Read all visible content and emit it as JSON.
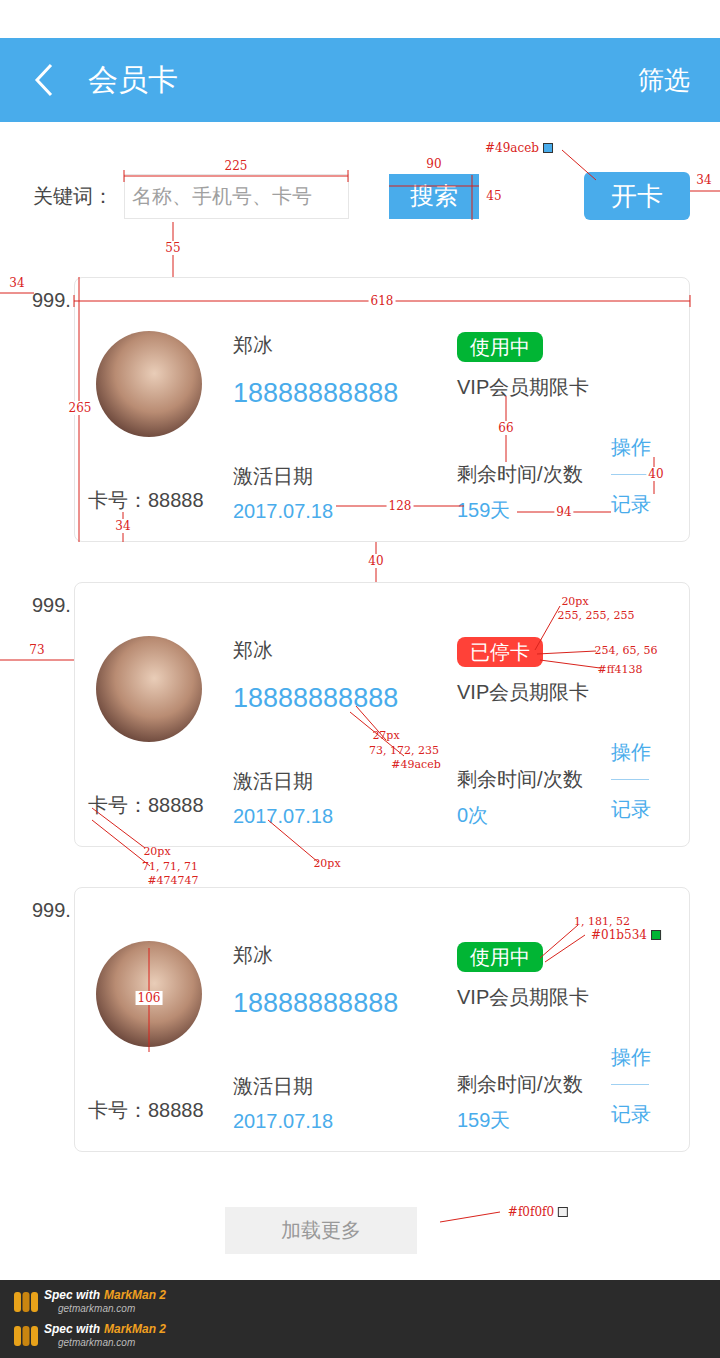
{
  "header": {
    "title": "会员卡",
    "action": "筛选"
  },
  "search": {
    "label": "关键词：",
    "placeholder": "名称、手机号、卡号",
    "button": "搜索"
  },
  "open_card_button": "开卡",
  "cards": [
    {
      "index": "999.",
      "name": "郑冰",
      "phone": "18888888888",
      "status": "使用中",
      "color": "#01b534",
      "card_type": "VIP会员期限卡",
      "card_no": "卡号：88888",
      "activation_label": "激活日期",
      "activation_date": "2017.07.18",
      "remaining_label": "剩余时间/次数",
      "remaining": "159天",
      "operate": "操作",
      "records": "记录"
    },
    {
      "index": "999.",
      "name": "郑冰",
      "phone": "18888888888",
      "status": "已停卡",
      "color": "#ff4138",
      "card_type": "VIP会员期限卡",
      "card_no": "卡号：88888",
      "activation_label": "激活日期",
      "activation_date": "2017.07.18",
      "remaining_label": "剩余时间/次数",
      "remaining": "0次",
      "operate": "操作",
      "records": "记录"
    },
    {
      "index": "999.",
      "name": "郑冰",
      "phone": "18888888888",
      "status": "使用中",
      "color": "#01b534",
      "card_type": "VIP会员期限卡",
      "card_no": "卡号：88888",
      "activation_label": "激活日期",
      "activation_date": "2017.07.18",
      "remaining_label": "剩余时间/次数",
      "remaining": "159天",
      "operate": "操作",
      "records": "记录"
    }
  ],
  "load_more": "加载更多",
  "annotations": [
    {
      "text": "225",
      "kind": "dim"
    },
    {
      "text": "90",
      "kind": "dim"
    },
    {
      "text": "45",
      "kind": "dim"
    },
    {
      "text": "#49aceb",
      "kind": "swatch",
      "color": "#49aceb"
    },
    {
      "text": "34",
      "kind": "dim"
    },
    {
      "text": "55",
      "kind": "dim"
    },
    {
      "text": "34",
      "kind": "dim"
    },
    {
      "text": "618",
      "kind": "dim"
    },
    {
      "text": "265",
      "kind": "dim"
    },
    {
      "text": "34",
      "kind": "dim"
    },
    {
      "text": "66",
      "kind": "dim"
    },
    {
      "text": "40",
      "kind": "dim"
    },
    {
      "text": "128",
      "kind": "dim"
    },
    {
      "text": "94",
      "kind": "dim"
    },
    {
      "text": "40",
      "kind": "dim"
    },
    {
      "text": "73",
      "kind": "dim"
    },
    {
      "text": "20px",
      "kind": "note"
    },
    {
      "text": "255, 255, 255",
      "kind": "note"
    },
    {
      "text": "254, 65, 56",
      "kind": "note"
    },
    {
      "text": "#ff4138",
      "kind": "note"
    },
    {
      "text": "27px",
      "kind": "note"
    },
    {
      "text": "73, 172, 235",
      "kind": "note"
    },
    {
      "text": "#49aceb",
      "kind": "note"
    },
    {
      "text": "20px",
      "kind": "note"
    },
    {
      "text": "71, 71, 71",
      "kind": "note"
    },
    {
      "text": "#474747",
      "kind": "note"
    },
    {
      "text": "20px",
      "kind": "note"
    },
    {
      "text": "1, 181, 52",
      "kind": "note"
    },
    {
      "text": "#01b534",
      "kind": "swatch",
      "color": "#01b534"
    },
    {
      "text": "106",
      "kind": "dim"
    },
    {
      "text": "#f0f0f0",
      "kind": "swatch",
      "color": "#f0f0f0"
    }
  ],
  "footer": [
    {
      "prefix": "Spec with",
      "brand": "MarkMan 2",
      "url": "getmarkman.com"
    },
    {
      "prefix": "Spec with",
      "brand": "MarkMan 2",
      "url": "getmarkman.com"
    }
  ]
}
